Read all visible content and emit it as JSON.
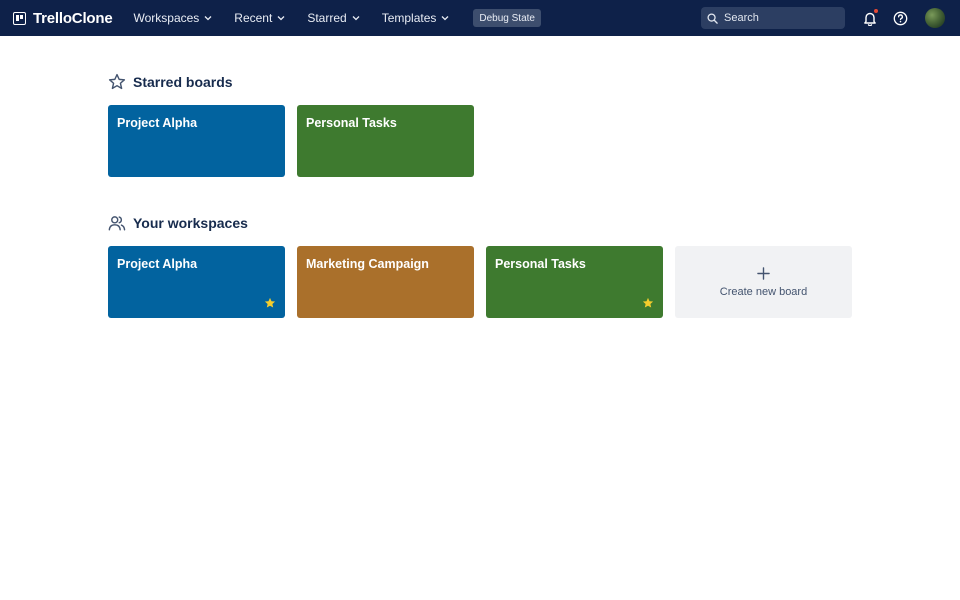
{
  "header": {
    "brand": "TrelloClone",
    "nav": [
      {
        "label": "Workspaces"
      },
      {
        "label": "Recent"
      },
      {
        "label": "Starred"
      },
      {
        "label": "Templates"
      }
    ],
    "debug_label": "Debug State",
    "search_placeholder": "Search",
    "notification_dot_color": "#e34935"
  },
  "starred": {
    "title": "Starred boards",
    "boards": [
      {
        "title": "Project Alpha",
        "color": "#02639f",
        "starred": true
      },
      {
        "title": "Personal Tasks",
        "color": "#3e7a2f",
        "starred": true
      }
    ]
  },
  "workspaces": {
    "title": "Your workspaces",
    "boards": [
      {
        "title": "Project Alpha",
        "color": "#02639f",
        "starred": true
      },
      {
        "title": "Marketing Campaign",
        "color": "#aa702b",
        "starred": false
      },
      {
        "title": "Personal Tasks",
        "color": "#3e7a2f",
        "starred": true
      }
    ],
    "create_label": "Create new board",
    "create_icon": "plus-icon"
  },
  "colors": {
    "header_bg": "#0e2149",
    "star_yellow": "#f5cd2d"
  }
}
